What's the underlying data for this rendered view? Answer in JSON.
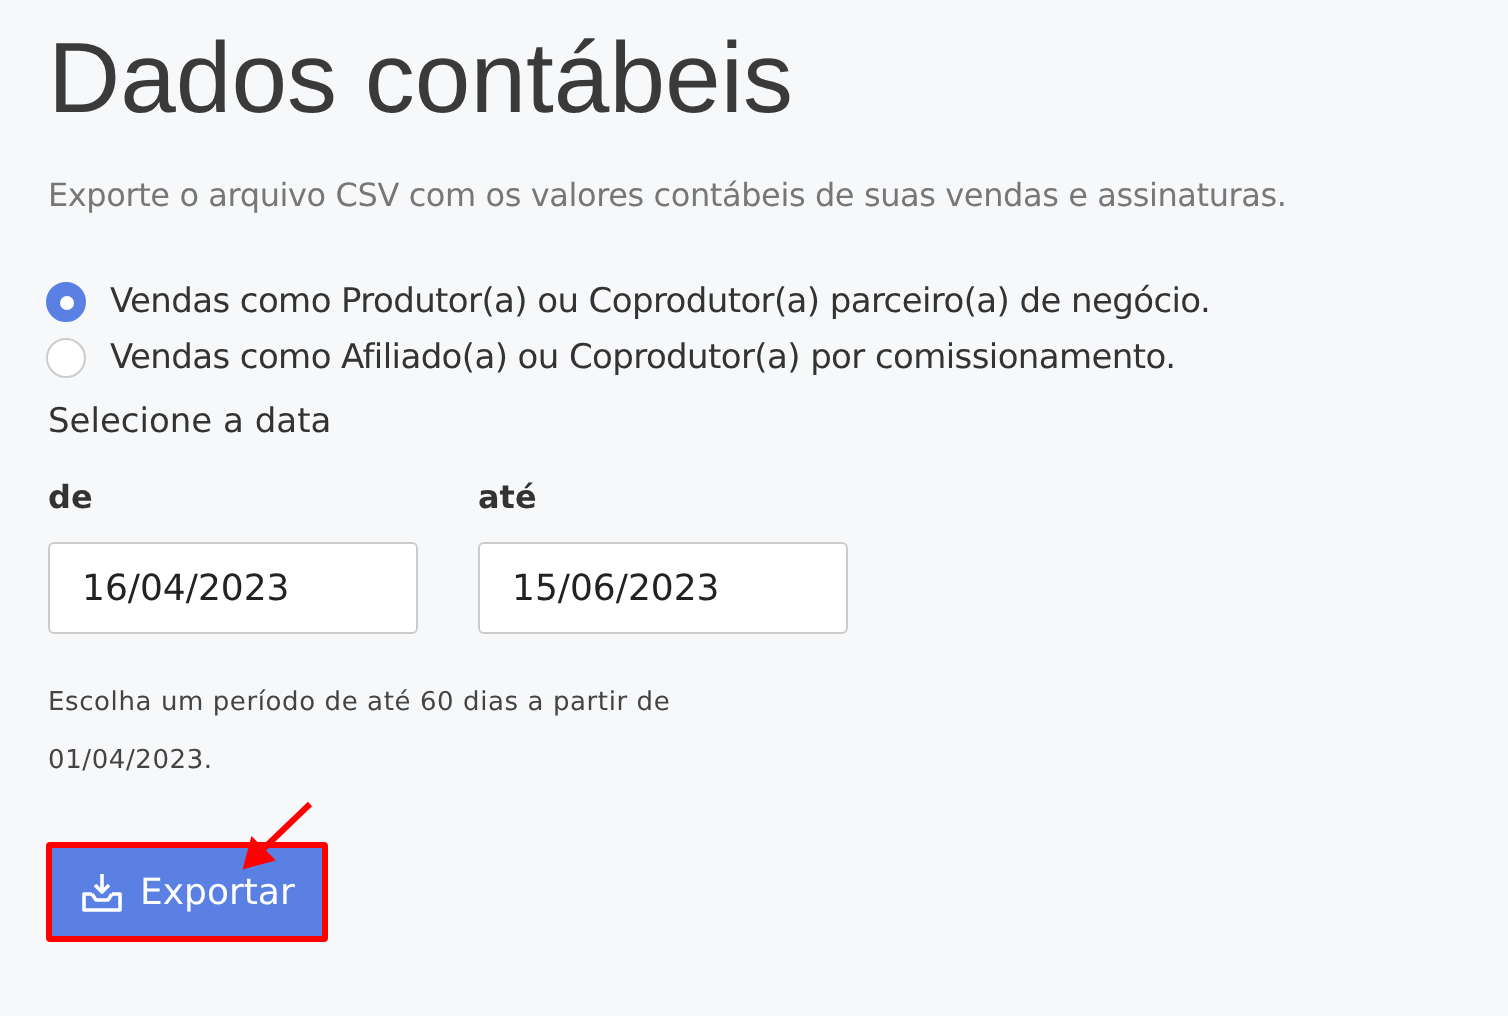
{
  "title": "Dados contábeis",
  "description": "Exporte o arquivo CSV com os valores contábeis de suas vendas e assinaturas.",
  "options": [
    {
      "label": "Vendas como Produtor(a) ou Coprodutor(a) parceiro(a) de negócio.",
      "selected": true
    },
    {
      "label": "Vendas como Afiliado(a) ou Coprodutor(a) por comissionamento.",
      "selected": false
    }
  ],
  "date_prompt": "Selecione a data",
  "date_fields": [
    {
      "label": "de",
      "value": "16/04/2023"
    },
    {
      "label": "até",
      "value": "15/06/2023"
    }
  ],
  "hint": "Escolha um período de até 60 dias a partir de 01/04/2023.",
  "export_button": {
    "label": "Exportar"
  }
}
